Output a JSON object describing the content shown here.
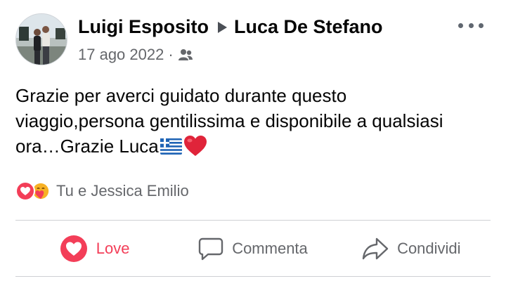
{
  "post": {
    "author": "Luigi Esposito",
    "target": "Luca De Stefano",
    "date": "17 ago 2022",
    "separator": "·",
    "privacy_icon": "friends-icon",
    "text": "Grazie per averci guidato durante questo viaggio,persona gentilissima e disponibile a qualsiasi ora…Grazie Luca",
    "text_emojis": [
      "greek-flag",
      "red-heart"
    ]
  },
  "reactions": {
    "icons": [
      "love-reaction-icon",
      "care-reaction-icon"
    ],
    "summary": "Tu e Jessica Emilio"
  },
  "actions": {
    "love": "Love",
    "comment": "Commenta",
    "share": "Condividi"
  },
  "colors": {
    "love": "#f33e58",
    "secondary_text": "#65676b",
    "primary_text": "#050505",
    "divider": "#ced0d4"
  }
}
